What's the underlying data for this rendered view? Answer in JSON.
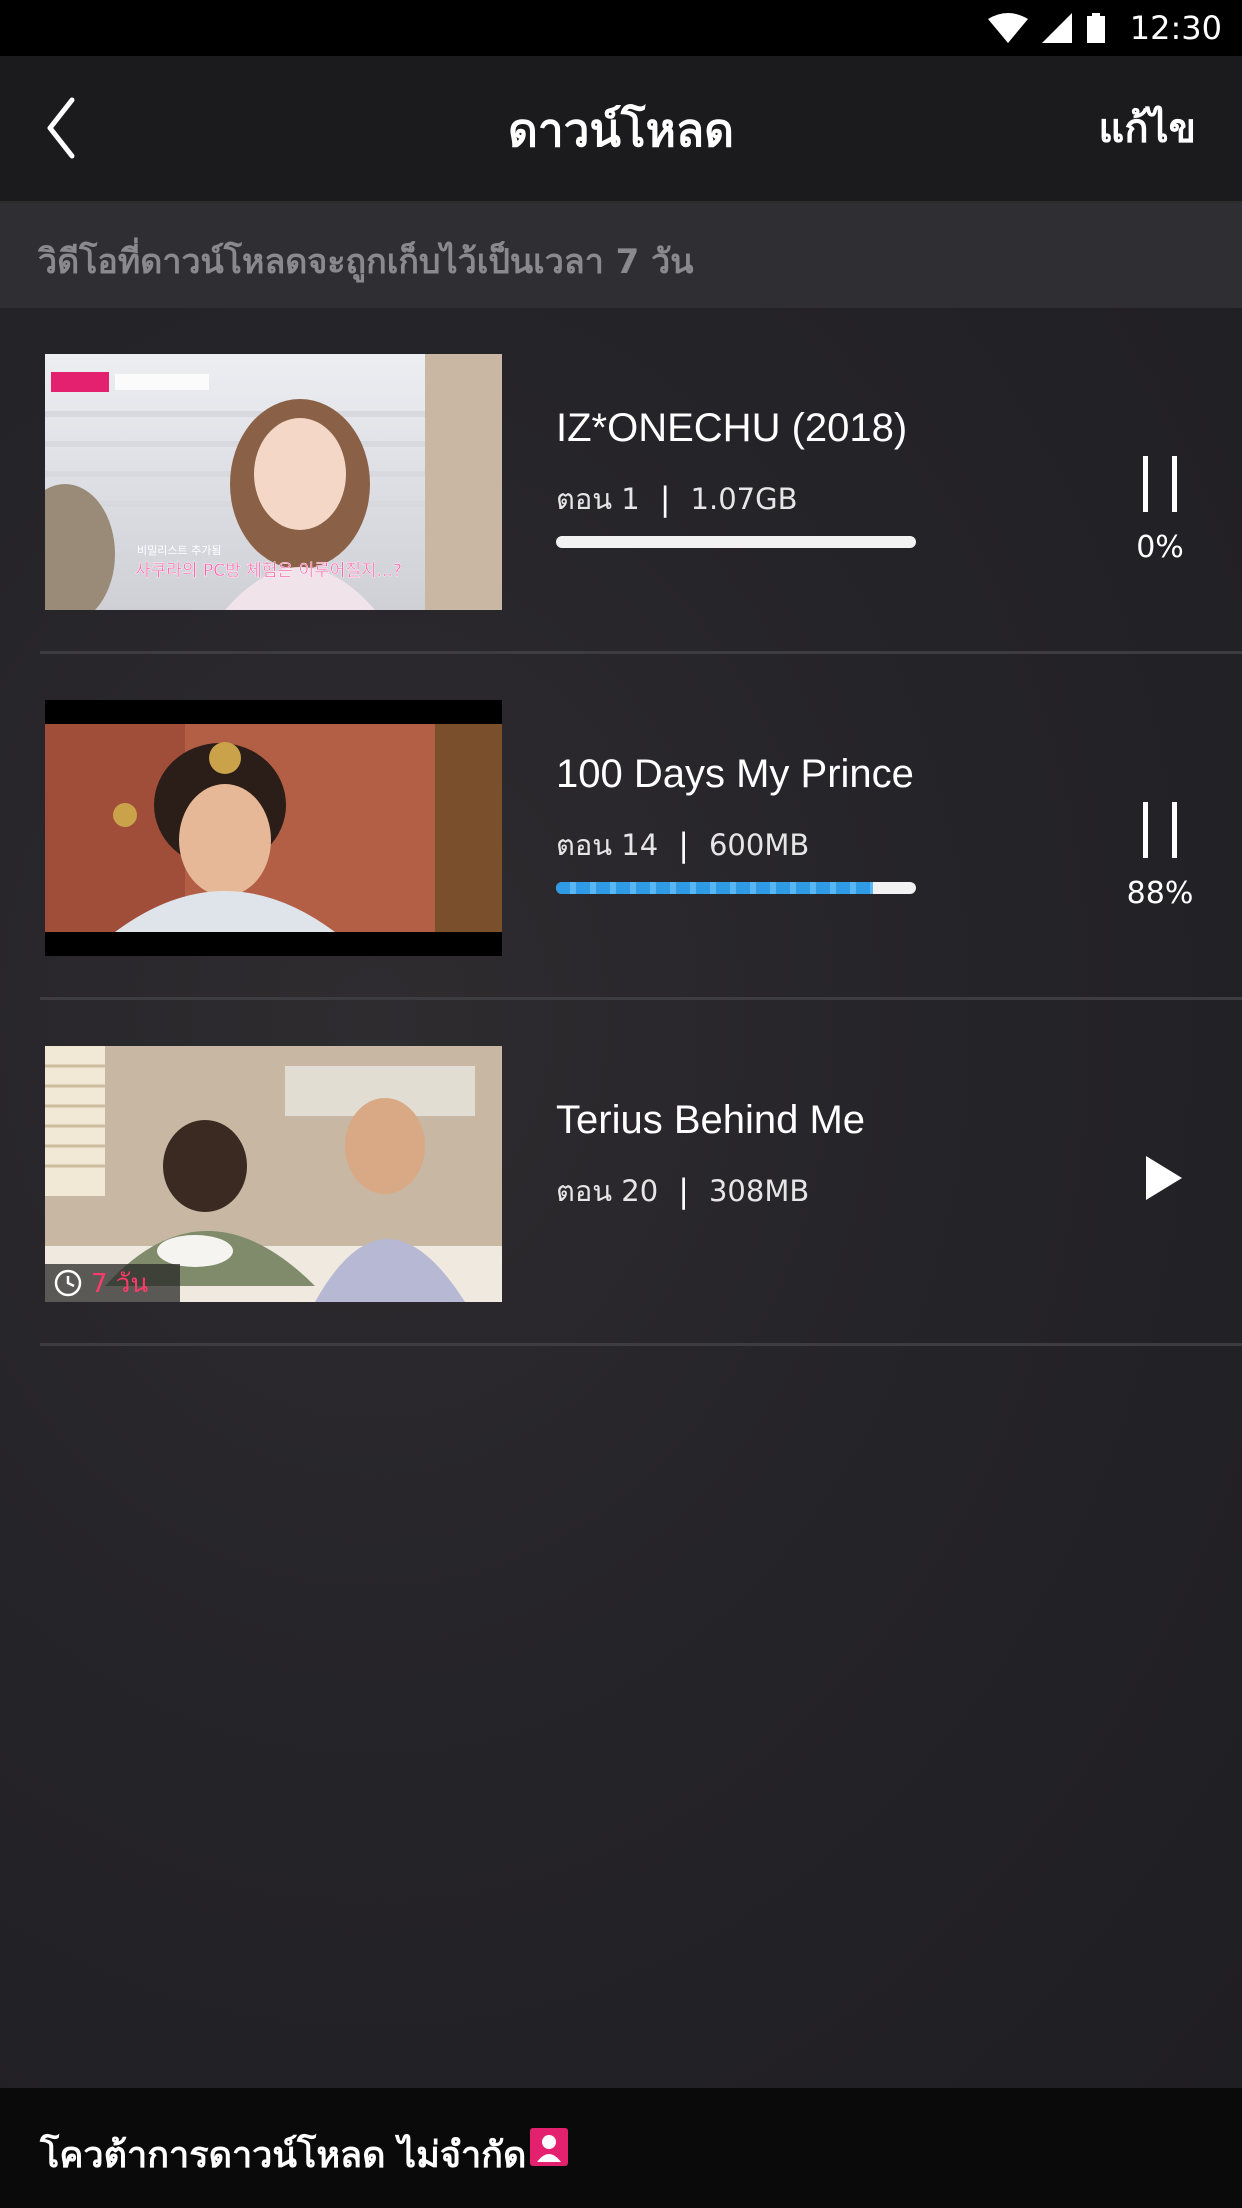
{
  "status_bar": {
    "time": "12:30"
  },
  "header": {
    "title": "ดาวน์โหลด",
    "edit_label": "แก้ไข"
  },
  "notice": {
    "text": "วิดีโอที่ดาวน์โหลดจะถูกเก็บไว้เป็นเวลา 7  วัน"
  },
  "downloads": [
    {
      "title": "IZ*ONECHU (2018)",
      "episode": "ตอน 1",
      "size": "1.07GB",
      "status": "paused",
      "progress": 0,
      "progress_label": "0%",
      "thumb_caption_top": "비밀리스트 추가됨",
      "thumb_caption": "사쿠라의 PC방 체험은 이루어질지...?"
    },
    {
      "title": "100 Days My Prince",
      "episode": "ตอน 14",
      "size": "600MB",
      "status": "paused",
      "progress": 88,
      "progress_label": "88%"
    },
    {
      "title": "Terius Behind Me",
      "episode": "ตอน 20",
      "size": "308MB",
      "status": "complete",
      "expiry": "7 วัน"
    }
  ],
  "bottom_bar": {
    "quota_text": "โควต้าการดาวน์โหลด ไม่จำกัด"
  },
  "colors": {
    "accent": "#e3216f",
    "progress": "#2f9be6",
    "expiry": "#ff3b6b"
  }
}
